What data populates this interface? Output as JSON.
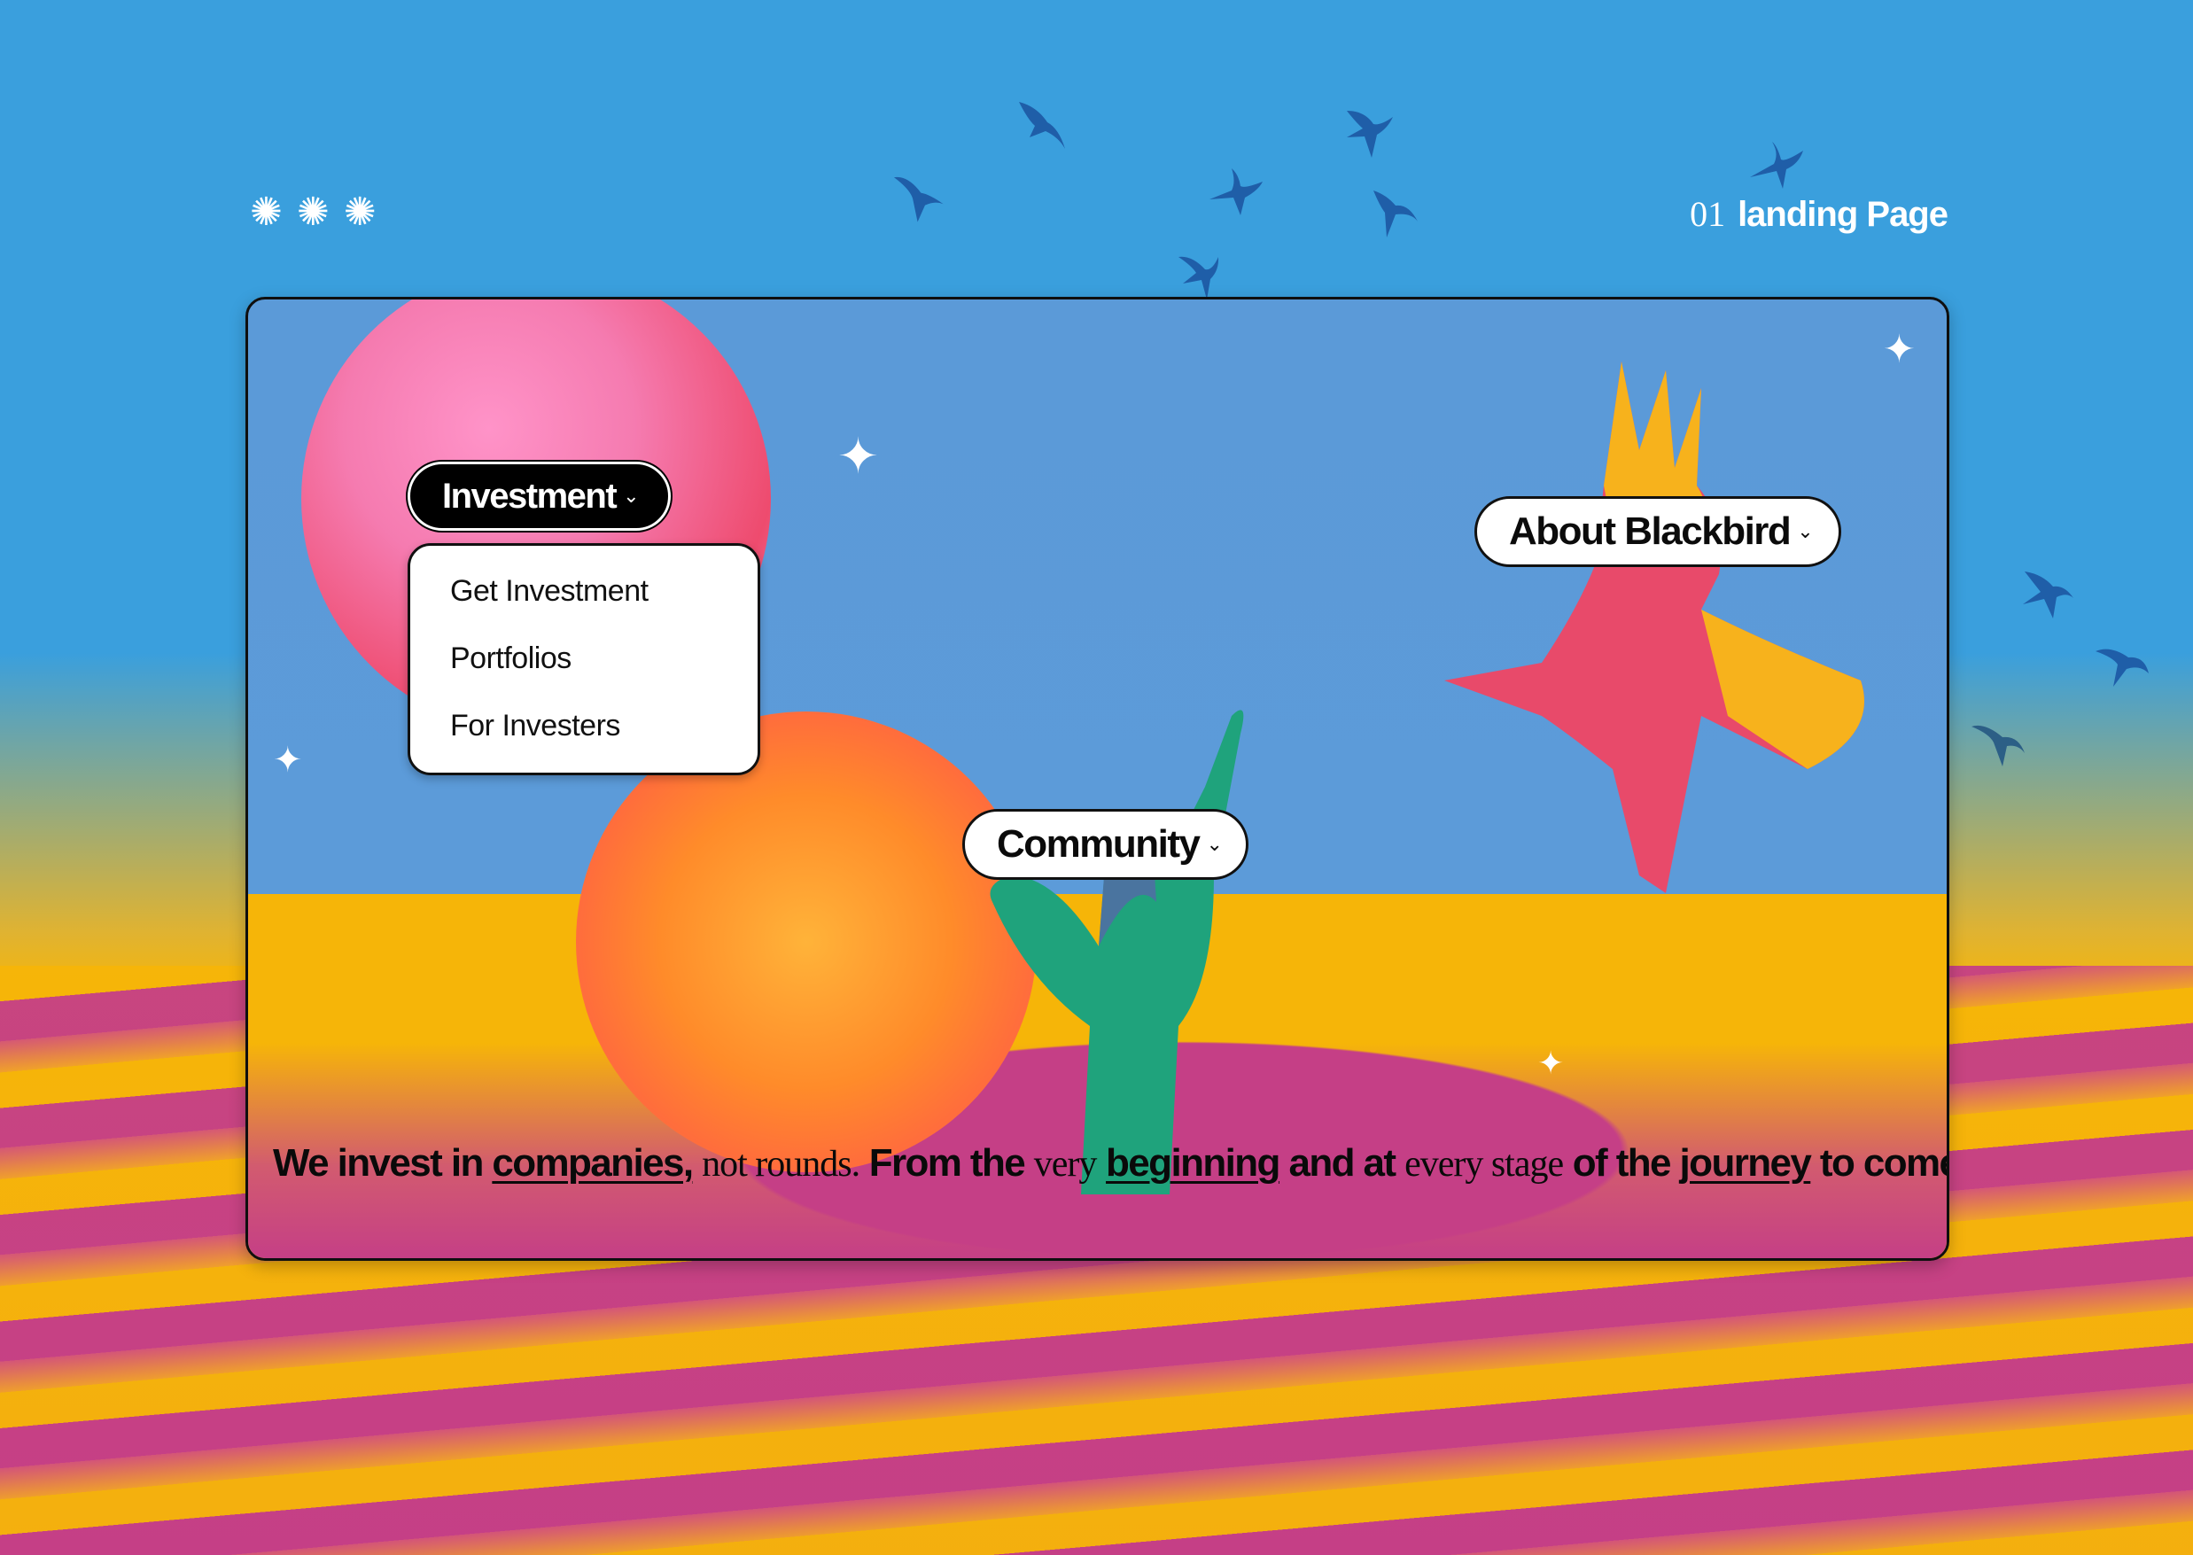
{
  "header": {
    "decor_stars": [
      "✺",
      "✺",
      "✺"
    ],
    "page_number": "01",
    "page_title": "landing Page"
  },
  "nav": {
    "investment": {
      "label": "Investment",
      "chevron": "⌄"
    },
    "investment_menu": {
      "items": [
        "Get Investment",
        "Portfolios",
        "For Investers"
      ]
    },
    "about": {
      "label": "About Blackbird",
      "chevron": "⌄"
    },
    "community": {
      "label": "Community",
      "chevron": "⌄"
    }
  },
  "hero": {
    "tagline": {
      "p1": "We invest in",
      "p2": "companies,",
      "p3": "not rounds.",
      "p4": "From the",
      "p5": "very",
      "p6": "beginning",
      "p7": "and at",
      "p8": "every stage",
      "p9": "of the",
      "p10": "journey",
      "p11": "to come."
    }
  },
  "icons": {
    "sparkle": "✦",
    "decor_star": "✺"
  },
  "colors": {
    "sky": "#3a9fdd",
    "card_sky": "#5b9ad8",
    "sand": "#f6b508",
    "magenta": "#c53f86",
    "eagle_red": "#e84a6a",
    "eagle_yellow": "#f7b21c",
    "hand_green": "#1fa37c",
    "bird_blue": "#1f5ea8"
  }
}
